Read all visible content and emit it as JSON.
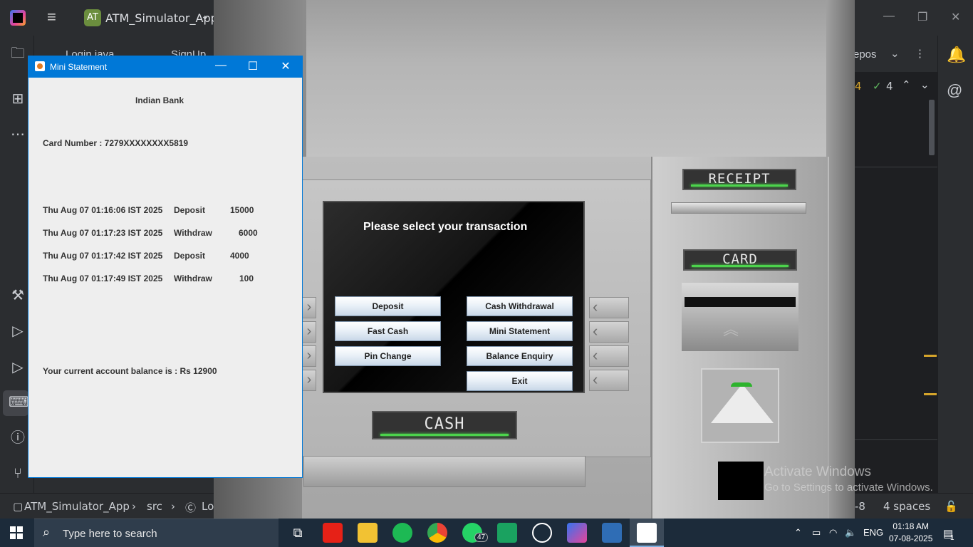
{
  "ide": {
    "project_badge": "AT",
    "project_name": "ATM_Simulator_App",
    "tabs": [
      "Login.java",
      "SignUp"
    ],
    "tab_partial_right": "epos",
    "inspection_warn_count": "4",
    "inspection_ok_count": "4",
    "status": {
      "breadcrumb_project": "ATM_Simulator_App",
      "breadcrumb_src": "src",
      "breadcrumb_file": "Lo",
      "encoding_partial": "-8",
      "indent": "4 spaces"
    }
  },
  "atm": {
    "screen_title": "Please select your transaction",
    "buttons": {
      "deposit": "Deposit",
      "cash_withdrawal": "Cash Withdrawal",
      "fast_cash": "Fast Cash",
      "mini_statement": "Mini Statement",
      "pin_change": "Pin Change",
      "balance_enquiry": "Balance Enquiry",
      "exit": "Exit"
    },
    "labels": {
      "receipt": "RECEIPT",
      "card": "CARD",
      "cash": "CASH"
    }
  },
  "mini_statement": {
    "window_title": "Mini Statement",
    "bank_name": "Indian Bank",
    "card_number": "Card Number : 7279XXXXXXXX5819",
    "transactions": [
      {
        "date": "Thu Aug 07 01:16:06 IST 2025",
        "type": "Deposit",
        "amount": "15000"
      },
      {
        "date": "Thu Aug 07 01:17:23 IST 2025",
        "type": "Withdraw",
        "amount": "6000"
      },
      {
        "date": "Thu Aug 07 01:17:42 IST 2025",
        "type": "Deposit",
        "amount": "4000"
      },
      {
        "date": "Thu Aug 07 01:17:49 IST 2025",
        "type": "Withdraw",
        "amount": "100"
      }
    ],
    "balance": "Your current account balance is : Rs 12900"
  },
  "watermark": {
    "line1": "Activate Windows",
    "line2": "Go to Settings to activate Windows."
  },
  "taskbar": {
    "search_placeholder": "Type here to search",
    "whatsapp_badge": "47",
    "language": "ENG",
    "time": "01:18 AM",
    "date": "07-08-2025",
    "notification_count": "1"
  }
}
